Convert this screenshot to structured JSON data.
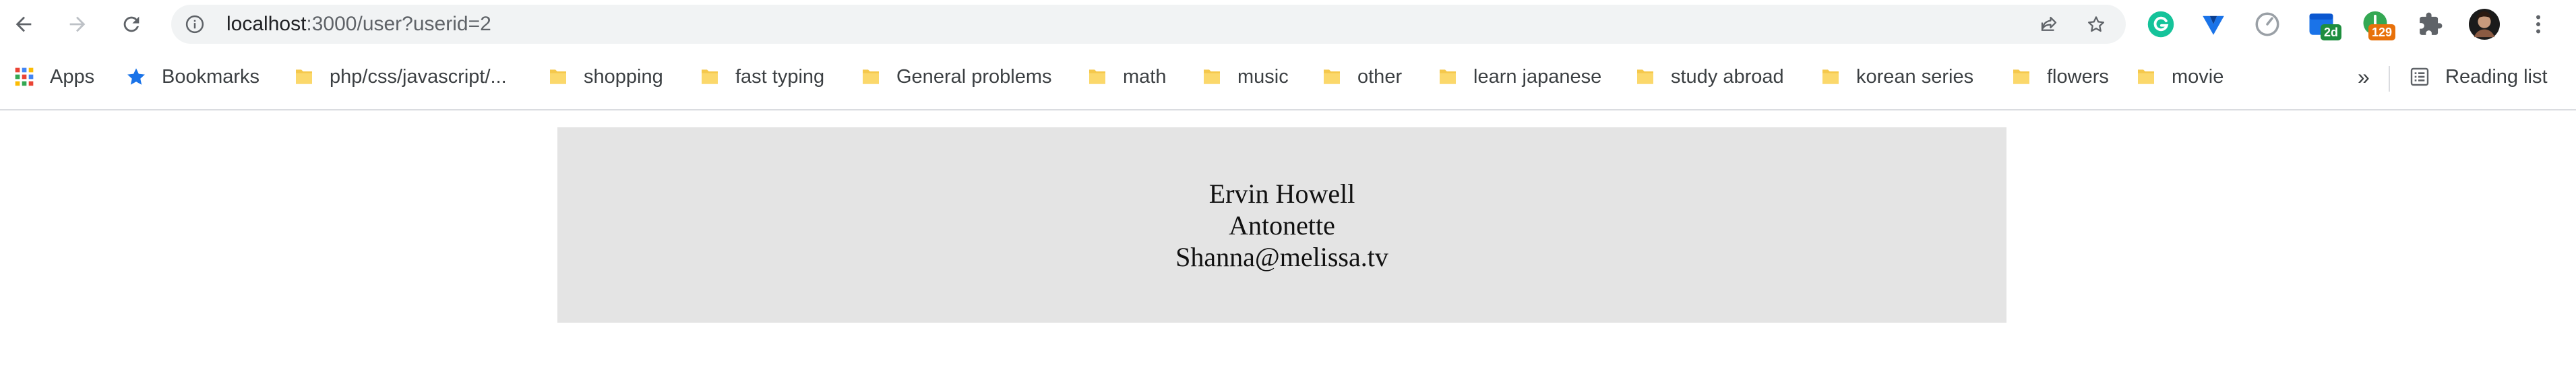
{
  "browser": {
    "url_host": "localhost",
    "url_path": ":3000/user?userid=2",
    "extensions": [
      {
        "name": "grammarly-icon",
        "color": "#15c39a"
      },
      {
        "name": "vpn-extension-icon",
        "color": "#1a73e8"
      },
      {
        "name": "speed-extension-icon",
        "color": "#9aa0a6"
      },
      {
        "name": "calendar-extension-icon",
        "color": "#1a73e8",
        "badge": "2d",
        "badge_color": "#1e8e3e"
      },
      {
        "name": "notification-extension-icon",
        "color": "#34a853",
        "badge": "129",
        "badge_color": "#e8710a"
      },
      {
        "name": "extensions-puzzle-icon",
        "color": "#5f6368"
      }
    ]
  },
  "bookmarks": {
    "apps_label": "Apps",
    "bookmarks_label": "Bookmarks",
    "folders": [
      "php/css/javascript/...",
      "shopping",
      "fast typing",
      "General problems",
      "math",
      "music",
      "other",
      "learn japanese",
      "study abroad",
      "korean series",
      "flowers",
      "movie"
    ],
    "overflow_label": "»",
    "reading_list_label": "Reading list"
  },
  "user": {
    "name": "Ervin Howell",
    "username": "Antonette",
    "email": "Shanna@melissa.tv"
  },
  "colors": {
    "card_background": "#e4e4e4",
    "folder": "#f5c84c",
    "bookmark_star": "#1a73e8"
  }
}
